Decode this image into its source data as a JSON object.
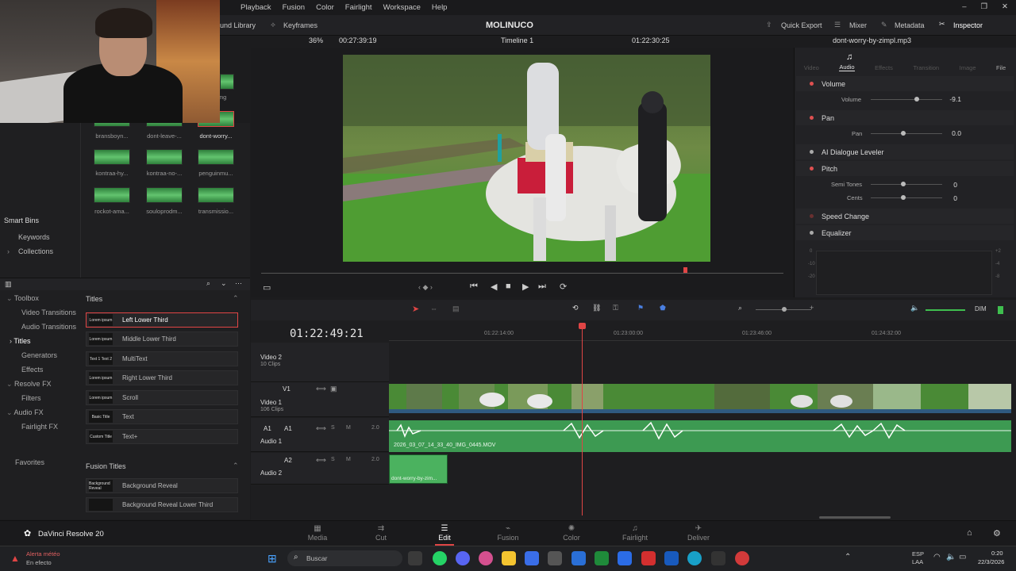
{
  "menu": [
    "Playback",
    "Fusion",
    "Color",
    "Fairlight",
    "Workspace",
    "Help"
  ],
  "toolbar_top": {
    "sound_library": "und Library",
    "keyframes": "Keyframes",
    "project_name": "MOLINUCO",
    "quick_export": "Quick Export",
    "mixer": "Mixer",
    "metadata": "Metadata",
    "inspector": "Inspector"
  },
  "viewer_bar": {
    "zoom": "36%",
    "source_timecode": "00:27:39:19",
    "timeline_name": "Timeline 1",
    "record_timecode": "01:22:30:25",
    "clip_name": "dont-worry-by-zimpl.mp3"
  },
  "media_pool": {
    "bins": [
      {
        "label": "bransboyn..."
      },
      {
        "label": "dont-leave-..."
      },
      {
        "label": "dont-worry..."
      },
      {
        "label": "kontraa-hy..."
      },
      {
        "label": "kontraa-no-..."
      },
      {
        "label": "penguinmu..."
      },
      {
        "label": "rockot-ama..."
      },
      {
        "label": "souloprodm..."
      },
      {
        "label": "transmissio..."
      }
    ],
    "partial_label": "...mg",
    "smart_bins": "Smart Bins",
    "keywords": "Keywords",
    "collections": "Collections"
  },
  "effects": {
    "tree": [
      {
        "label": "Toolbox",
        "indent": 0
      },
      {
        "label": "Video Transitions",
        "indent": 1
      },
      {
        "label": "Audio Transitions",
        "indent": 1
      },
      {
        "label": "Titles",
        "indent": 1
      },
      {
        "label": "Generators",
        "indent": 1
      },
      {
        "label": "Effects",
        "indent": 1
      },
      {
        "label": "Resolve FX",
        "indent": 0
      },
      {
        "label": "Filters",
        "indent": 1
      },
      {
        "label": "Audio FX",
        "indent": 0
      },
      {
        "label": "Fairlight FX",
        "indent": 1
      }
    ],
    "favorites": "Favorites",
    "titles_header": "Titles",
    "titles": [
      {
        "label": "Left Lower Third",
        "thumb": "Lorem ipsum"
      },
      {
        "label": "Middle Lower Third",
        "thumb": "Lorem ipsum"
      },
      {
        "label": "MultiText",
        "thumb": "Text 1 Text 2"
      },
      {
        "label": "Right Lower Third",
        "thumb": "Lorem ipsum"
      },
      {
        "label": "Scroll",
        "thumb": "Lorem ipsum"
      },
      {
        "label": "Text",
        "thumb": "Basic Title"
      },
      {
        "label": "Text+",
        "thumb": "Custom Title"
      }
    ],
    "fusion_header": "Fusion Titles",
    "fusion_titles": [
      {
        "label": "Background Reveal",
        "thumb": "Background Reveal"
      },
      {
        "label": "Background Reveal Lower Third",
        "thumb": ""
      }
    ]
  },
  "inspector": {
    "tabs": [
      "Video",
      "Audio",
      "Effects",
      "Transition",
      "Image",
      "File"
    ],
    "active_tab": "Audio",
    "sections": {
      "volume": {
        "title": "Volume",
        "param": "Volume",
        "value": "-9.1"
      },
      "pan": {
        "title": "Pan",
        "param": "Pan",
        "value": "0.0"
      },
      "ai": {
        "title": "AI Dialogue Leveler"
      },
      "pitch": {
        "title": "Pitch",
        "semi_label": "Semi Tones",
        "semi_value": "0",
        "cents_label": "Cents",
        "cents_value": "0"
      },
      "speed": {
        "title": "Speed Change"
      },
      "eq": {
        "title": "Equalizer",
        "scale": [
          "0",
          "-10",
          "-20"
        ],
        "scale_right": [
          "+2",
          "-4",
          "-8"
        ]
      }
    }
  },
  "timeline": {
    "timecode": "01:22:49:21",
    "ruler": [
      "01:22:14:00",
      "01:23:00:00",
      "01:23:46:00",
      "01:24:32:00"
    ],
    "tracks": [
      {
        "name": "Video 2",
        "clips": "10 Clips"
      },
      {
        "name": "Video 1",
        "tag": "V1",
        "clips": "106 Clips"
      },
      {
        "name": "Audio 1",
        "tag": "A1",
        "level": "2.0"
      },
      {
        "name": "Audio 2",
        "tag": "A2",
        "level": "2.0"
      }
    ],
    "audio_clip": "2026_03_07_14_33_40_IMG_0445.MOV",
    "audio2_clip": "dont-worry-by-zim...",
    "dim": "DIM"
  },
  "pages": [
    "Media",
    "Cut",
    "Edit",
    "Fusion",
    "Color",
    "Fairlight",
    "Deliver"
  ],
  "active_page": "Edit",
  "app_name": "DaVinci Resolve 20",
  "taskbar": {
    "alert_title": "Alerta météo",
    "alert_sub": "En efecto",
    "search": "Buscar",
    "lang": "ESP",
    "lang2": "LAA",
    "time": "0:20",
    "date": "22/3/2026"
  }
}
